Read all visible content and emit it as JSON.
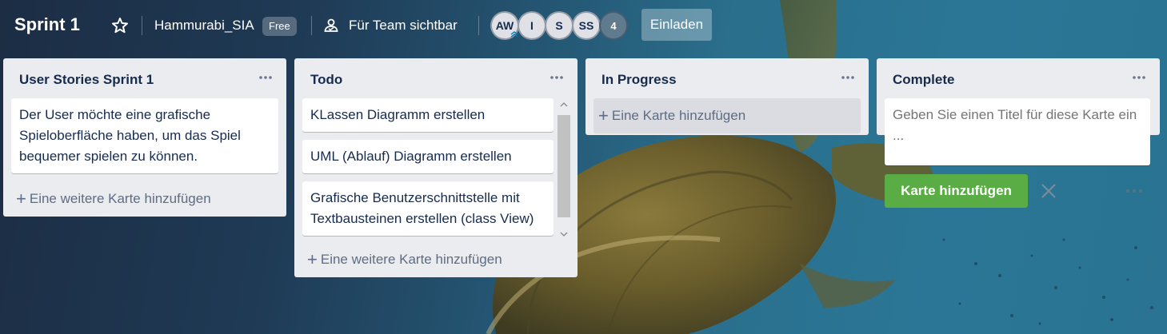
{
  "board": {
    "title": "Sprint 1",
    "workspace": "Hammurabi_SIA",
    "plan_badge": "Free",
    "visibility_label": "Für Team sichtbar",
    "members": [
      "AW",
      "I",
      "S",
      "SS"
    ],
    "extra_members": "4",
    "invite_label": "Einladen"
  },
  "icons": {
    "star": "star-icon",
    "visibility": "team-icon",
    "list_menu": "ellipsis-icon",
    "add": "plus-icon",
    "close": "close-icon",
    "scroll_up": "chevron-up-icon",
    "scroll_down": "chevron-down-icon"
  },
  "lists": [
    {
      "title": "User Stories Sprint 1",
      "cards": [
        "Der User möchte eine grafische Spieloberfläche haben, um das Spiel bequemer spielen zu können."
      ],
      "add_label": "Eine weitere Karte hinzufügen"
    },
    {
      "title": "Todo",
      "cards": [
        "KLassen Diagramm erstellen",
        "UML (Ablauf) Diagramm erstellen",
        "Grafische Benutzerschnittstelle mit Textbausteinen erstellen (class View)"
      ],
      "add_label": "Eine weitere Karte hinzufügen"
    },
    {
      "title": "In Progress",
      "cards": [],
      "add_label": "Eine Karte hinzufügen"
    },
    {
      "title": "Complete",
      "cards": [],
      "composer_placeholder": "Geben Sie einen Titel für diese Karte ein ...",
      "submit_label": "Karte hinzufügen"
    }
  ],
  "colors": {
    "list_bg": "#ebecf0",
    "card_text": "#172b4d",
    "add_button": "#5aac44",
    "muted_text": "#5e6c84"
  }
}
